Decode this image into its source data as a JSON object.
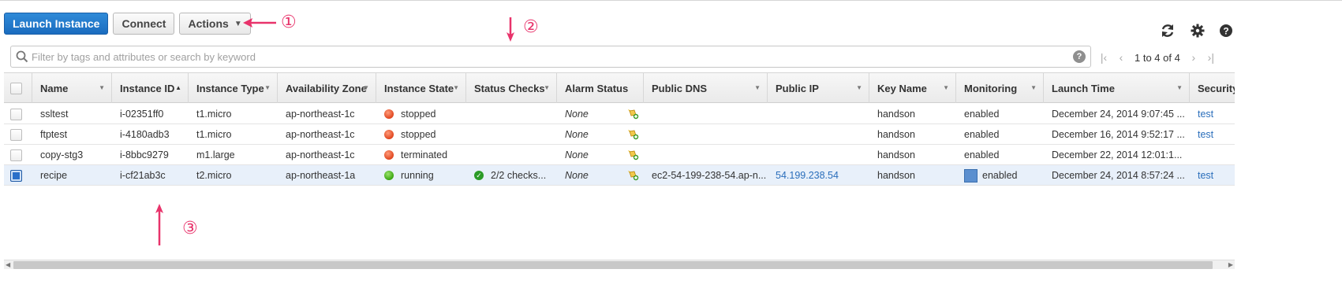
{
  "toolbar": {
    "launch_label": "Launch Instance",
    "connect_label": "Connect",
    "actions_label": "Actions"
  },
  "annotations": [
    "①",
    "②",
    "③"
  ],
  "search": {
    "placeholder": "Filter by tags and attributes or search by keyword",
    "help": "?"
  },
  "pager": {
    "text": "1 to 4 of 4"
  },
  "columns": [
    "Name",
    "Instance ID",
    "Instance Type",
    "Availability Zone",
    "Instance State",
    "Status Checks",
    "Alarm Status",
    "Public DNS",
    "Public IP",
    "Key Name",
    "Monitoring",
    "Launch Time",
    "Security"
  ],
  "rows": [
    {
      "name": "ssltest",
      "instance_id": "i-02351ff0",
      "type": "t1.micro",
      "zone": "ap-northeast-1c",
      "state": "stopped",
      "status_checks": "",
      "alarm": "None",
      "dns": "",
      "ip": "",
      "key": "handson",
      "monitoring": "enabled",
      "launch": "December 24, 2014 9:07:45 ...",
      "security": "test",
      "selected": false
    },
    {
      "name": "ftptest",
      "instance_id": "i-4180adb3",
      "type": "t1.micro",
      "zone": "ap-northeast-1c",
      "state": "stopped",
      "status_checks": "",
      "alarm": "None",
      "dns": "",
      "ip": "",
      "key": "handson",
      "monitoring": "enabled",
      "launch": "December 16, 2014 9:52:17 ...",
      "security": "test",
      "selected": false
    },
    {
      "name": "copy-stg3",
      "instance_id": "i-8bbc9279",
      "type": "m1.large",
      "zone": "ap-northeast-1c",
      "state": "terminated",
      "status_checks": "",
      "alarm": "None",
      "dns": "",
      "ip": "",
      "key": "handson",
      "monitoring": "enabled",
      "launch": "December 22, 2014 12:01:1...",
      "security": "",
      "selected": false
    },
    {
      "name": "recipe",
      "instance_id": "i-cf21ab3c",
      "type": "t2.micro",
      "zone": "ap-northeast-1a",
      "state": "running",
      "status_checks": "2/2 checks...",
      "alarm": "None",
      "dns": "ec2-54-199-238-54.ap-n...",
      "ip": "54.199.238.54",
      "key": "handson",
      "monitoring": "enabled",
      "launch": "December 24, 2014 8:57:24 ...",
      "security": "test",
      "selected": true
    }
  ],
  "colors": {
    "primary": "#1a6cbf",
    "annotation": "#e8336b",
    "link": "#2a6ebb",
    "running": "#3aa511",
    "stopped": "#e0461f"
  }
}
